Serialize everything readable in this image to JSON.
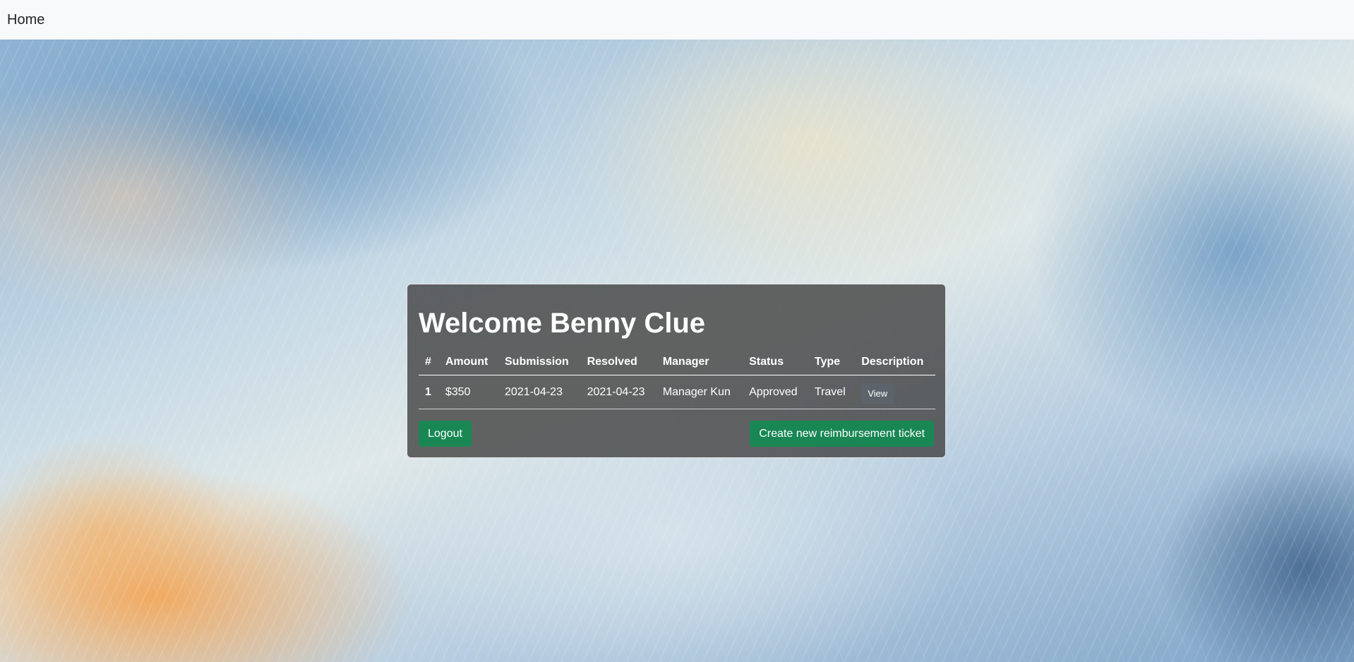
{
  "navbar": {
    "home_label": "Home"
  },
  "panel": {
    "title": "Welcome Benny Clue",
    "columns": [
      "#",
      "Amount",
      "Submission",
      "Resolved",
      "Manager",
      "Status",
      "Type",
      "Description"
    ],
    "rows": [
      {
        "num": "1",
        "amount": "$350",
        "submission": "2021-04-23",
        "resolved": "2021-04-23",
        "manager": "Manager Kun",
        "status": "Approved",
        "type": "Travel",
        "description_button": "View"
      }
    ],
    "logout_label": "Logout",
    "create_label": "Create new reimbursement ticket"
  },
  "colors": {
    "navbar_bg": "#f8f9fa",
    "panel_bg": "#444444",
    "success_button": "#198754",
    "secondary_button": "#5c636a"
  }
}
